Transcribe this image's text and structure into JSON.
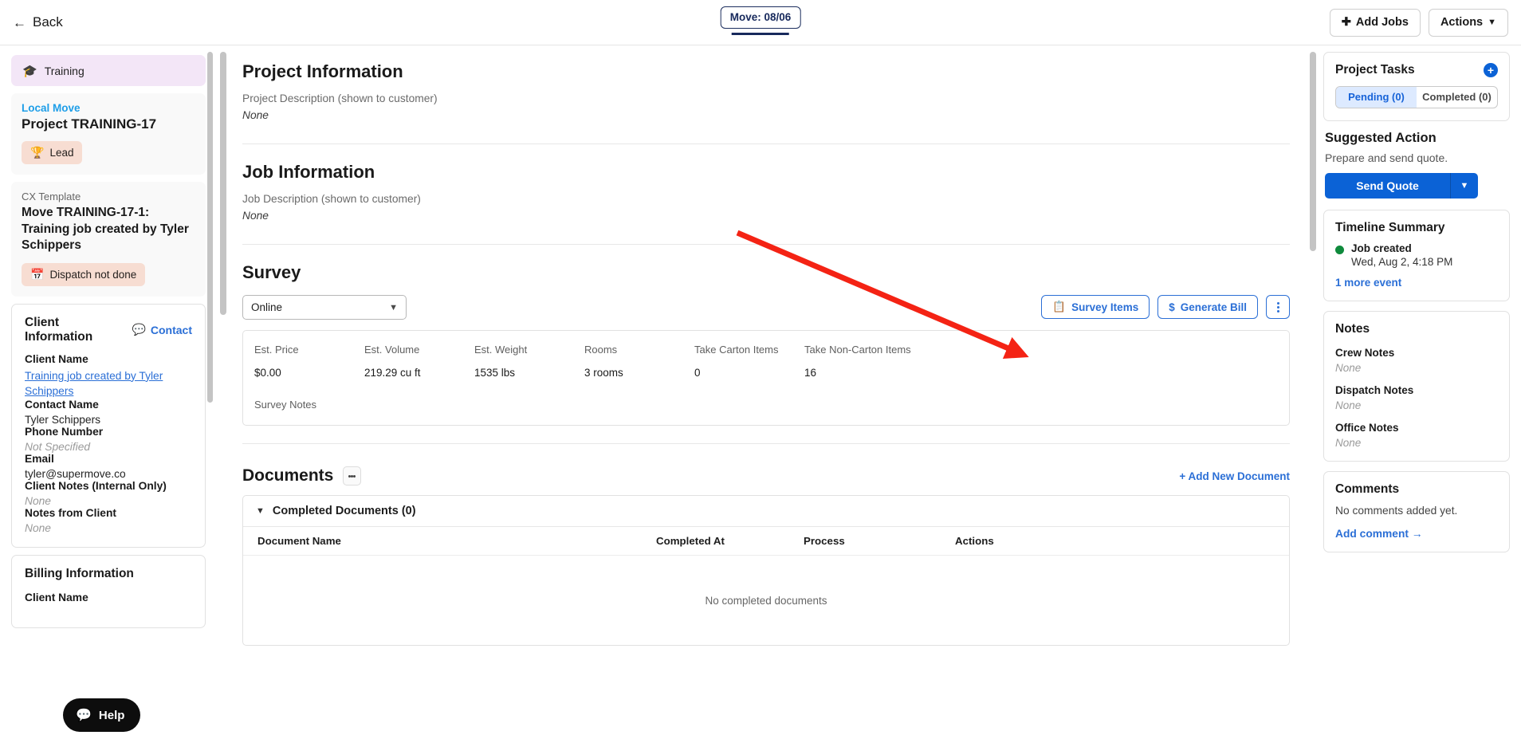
{
  "topbar": {
    "back_label": "Back",
    "back_icon": "arrow-left-icon",
    "tab_label": "Move: 08/06",
    "add_jobs_label": "Add Jobs",
    "add_jobs_icon": "plus-icon",
    "actions_label": "Actions",
    "actions_icon": "chevron-down-icon"
  },
  "sidebar": {
    "training_chip": {
      "label": "Training",
      "icon": "graduation-cap-icon"
    },
    "project_card": {
      "type_label": "Local Move",
      "title": "Project TRAINING-17",
      "status_label": "Lead",
      "status_icon": "trophy-icon"
    },
    "job_card": {
      "template_label": "CX Template",
      "title": "Move TRAINING-17-1: Training job created by Tyler Schippers",
      "status_label": "Dispatch not done",
      "status_icon": "calendar-check-icon"
    },
    "client_information": {
      "title": "Client Information",
      "chat_icon": "chat-bubble-icon",
      "contact_link": "Contact",
      "fields": [
        {
          "label": "Client Name",
          "value": "Training job created by Tyler Schippers",
          "style": "link"
        },
        {
          "label": "Contact Name",
          "value": "Tyler Schippers",
          "style": "plain"
        },
        {
          "label": "Phone Number",
          "value": "Not Specified",
          "style": "muted"
        },
        {
          "label": "Email",
          "value": "tyler@supermove.co",
          "style": "plain"
        },
        {
          "label": "Client Notes (Internal Only)",
          "value": "None",
          "style": "muted"
        },
        {
          "label": "Notes from Client",
          "value": "None",
          "style": "muted"
        }
      ]
    },
    "billing_information": {
      "title": "Billing Information",
      "first_field_label": "Client Name"
    }
  },
  "main": {
    "project_information": {
      "heading": "Project Information",
      "description_label": "Project Description (shown to customer)",
      "description_value": "None"
    },
    "job_information": {
      "heading": "Job Information",
      "description_label": "Job Description (shown to customer)",
      "description_value": "None"
    },
    "survey": {
      "heading": "Survey",
      "select_value": "Online",
      "select_icon": "chevron-down-icon",
      "survey_items_label": "Survey Items",
      "survey_items_icon": "clipboard-icon",
      "generate_bill_label": "Generate Bill",
      "generate_bill_icon": "dollar-icon",
      "more_icon": "kebab-menu-icon",
      "stats": [
        {
          "label": "Est. Price",
          "value": "$0.00"
        },
        {
          "label": "Est. Volume",
          "value": "219.29 cu ft"
        },
        {
          "label": "Est. Weight",
          "value": "1535  lbs"
        },
        {
          "label": "Rooms",
          "value": "3 rooms"
        },
        {
          "label": "Take Carton Items",
          "value": "0"
        },
        {
          "label": "Take Non-Carton Items",
          "value": "16"
        }
      ],
      "survey_notes_label": "Survey Notes"
    },
    "documents": {
      "heading": "Documents",
      "kebab_icon": "kebab-menu-icon",
      "add_new_label": "+ Add New Document",
      "group_label": "Completed Documents (0)",
      "group_caret_icon": "chevron-down-icon",
      "columns": [
        "Document Name",
        "Completed At",
        "Process",
        "Actions"
      ],
      "empty_text": "No completed documents"
    }
  },
  "right": {
    "project_tasks": {
      "title": "Project Tasks",
      "add_icon": "plus-circle-icon",
      "tabs": [
        {
          "label": "Pending (0)",
          "active": true
        },
        {
          "label": "Completed (0)",
          "active": false
        }
      ]
    },
    "suggested_action": {
      "title": "Suggested Action",
      "text": "Prepare and send quote.",
      "button_label": "Send Quote",
      "button_caret_icon": "caret-down-icon"
    },
    "timeline_summary": {
      "title": "Timeline Summary",
      "event_label": "Job created",
      "event_time": "Wed, Aug 2, 4:18 PM",
      "more_link": "1 more event",
      "dot_color": "#0f8a3c"
    },
    "notes": {
      "title": "Notes",
      "items": [
        {
          "label": "Crew Notes",
          "value": "None"
        },
        {
          "label": "Dispatch Notes",
          "value": "None"
        },
        {
          "label": "Office Notes",
          "value": "None"
        }
      ]
    },
    "comments": {
      "title": "Comments",
      "empty_text": "No comments added yet.",
      "add_link": "Add comment →"
    }
  },
  "help_widget": {
    "label": "Help",
    "icon": "chat-bubble-icon"
  },
  "annotation": {
    "color": "#f42314",
    "type": "arrow"
  },
  "colors": {
    "accent_blue": "#2b6fd6",
    "primary_blue": "#0b62d6",
    "navy": "#17295c",
    "green": "#0f8a3c",
    "annotation_red": "#f42314"
  }
}
